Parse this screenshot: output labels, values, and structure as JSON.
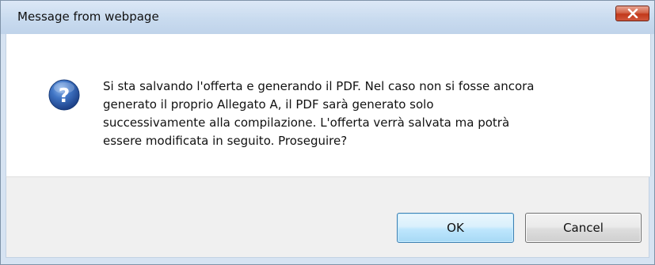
{
  "dialog": {
    "title": "Message from webpage",
    "close_icon": "close-icon",
    "icon": "question-icon",
    "message": "Si sta salvando l'offerta e generando il PDF. Nel caso non si fosse ancora\ngenerato il proprio Allegato A, il PDF sarà generato solo\nsuccessivamente alla compilazione. L'offerta verrà salvata ma potrà\nessere modificata in seguito. Proseguire?",
    "buttons": {
      "ok_label": "OK",
      "cancel_label": "Cancel"
    }
  },
  "colors": {
    "titlebar": "#c9dbef",
    "close_button": "#c2391a",
    "icon_blue": "#2f5fa8",
    "default_button_border": "#3c7fb1"
  }
}
